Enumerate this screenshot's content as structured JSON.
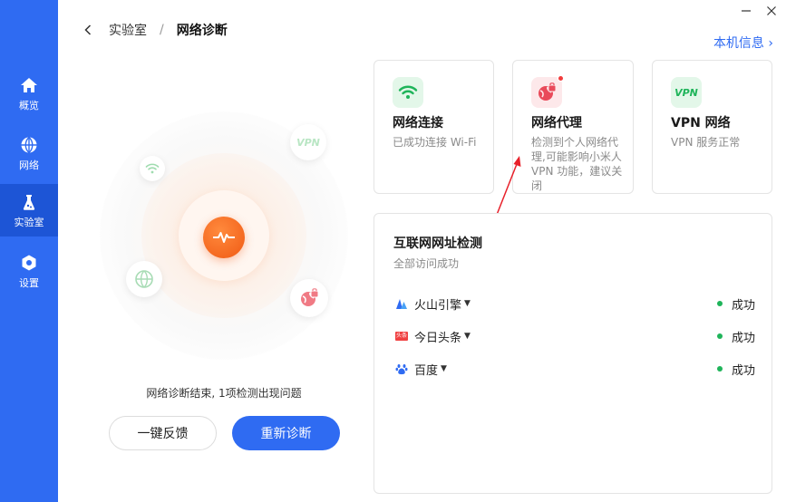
{
  "breadcrumb": {
    "parent": "实验室",
    "separator": "/",
    "current": "网络诊断"
  },
  "header": {
    "machine_info": "本机信息 ›"
  },
  "sidebar": {
    "items": [
      {
        "label": "概览",
        "icon": "home-icon"
      },
      {
        "label": "网络",
        "icon": "globe-icon"
      },
      {
        "label": "实验室",
        "icon": "flask-icon"
      },
      {
        "label": "设置",
        "icon": "settings-icon"
      }
    ],
    "active": "实验室"
  },
  "diagnosis": {
    "orbit_vpn_label": "VPN",
    "result_text": "网络诊断结束, 1项检测出现问题",
    "feedback_button": "一键反馈",
    "rediagnose_button": "重新诊断"
  },
  "cards": [
    {
      "title": "网络连接",
      "desc": "已成功连接 Wi-Fi",
      "icon": "wifi-icon",
      "status": "ok"
    },
    {
      "title": "网络代理",
      "desc": "检测到个人网络代理,可能影响小米人VPN 功能，建议关闭",
      "icon": "proxy-globe-icon",
      "status": "warning"
    },
    {
      "title": "VPN 网络",
      "desc": "VPN 服务正常",
      "icon": "vpn-icon",
      "icon_text": "VPN",
      "status": "ok"
    }
  ],
  "site_test": {
    "title": "互联网网址检测",
    "subtitle": "全部访问成功",
    "sites": [
      {
        "name": "火山引擎",
        "status": "成功",
        "icon": "volcano-icon"
      },
      {
        "name": "今日头条",
        "status": "成功",
        "icon": "toutiao-icon",
        "icon_text": "头条"
      },
      {
        "name": "百度",
        "status": "成功",
        "icon": "baidu-paw-icon"
      }
    ]
  },
  "colors": {
    "primary": "#2f6bf2",
    "accent_orange": "#f05a14",
    "success_green": "#1fb45a",
    "warning_red": "#f23c3c",
    "icon_green_bg": "#e3f7e9",
    "icon_red_bg": "#fde8ea"
  }
}
